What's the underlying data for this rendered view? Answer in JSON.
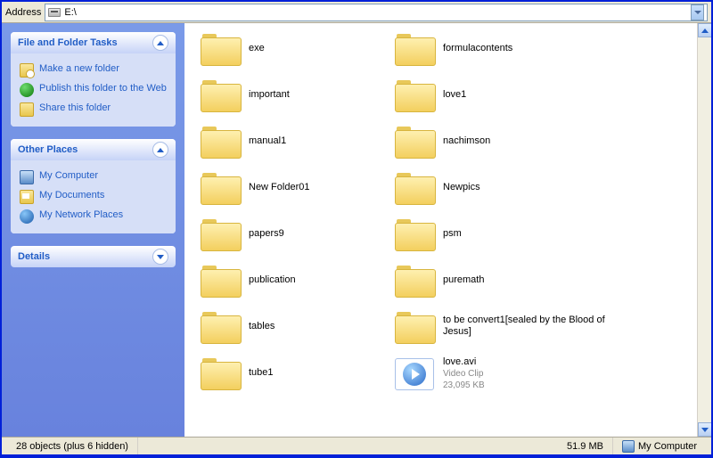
{
  "addressbar": {
    "label": "Address",
    "path": "E:\\"
  },
  "sidebar": {
    "panels": [
      {
        "title": "File and Folder Tasks",
        "expanded": true,
        "tasks": [
          {
            "label": "Make a new folder",
            "icon": "newfolder"
          },
          {
            "label": "Publish this folder to the Web",
            "icon": "publish"
          },
          {
            "label": "Share this folder",
            "icon": "share"
          }
        ]
      },
      {
        "title": "Other Places",
        "expanded": true,
        "tasks": [
          {
            "label": "My Computer",
            "icon": "mycomp"
          },
          {
            "label": "My Documents",
            "icon": "mydocs"
          },
          {
            "label": "My Network Places",
            "icon": "net"
          }
        ]
      },
      {
        "title": "Details",
        "expanded": false,
        "tasks": []
      }
    ]
  },
  "items": [
    {
      "name": "exe",
      "type": "folder"
    },
    {
      "name": "formulacontents",
      "type": "folder"
    },
    {
      "name": "important",
      "type": "folder"
    },
    {
      "name": "love1",
      "type": "folder"
    },
    {
      "name": "manual1",
      "type": "folder"
    },
    {
      "name": "nachimson",
      "type": "folder"
    },
    {
      "name": "New Folder01",
      "type": "folder"
    },
    {
      "name": "Newpics",
      "type": "folder"
    },
    {
      "name": "papers9",
      "type": "folder"
    },
    {
      "name": "psm",
      "type": "folder"
    },
    {
      "name": "publication",
      "type": "folder"
    },
    {
      "name": "puremath",
      "type": "folder"
    },
    {
      "name": "tables",
      "type": "folder"
    },
    {
      "name": "to be convert1[sealed by the Blood of Jesus]",
      "type": "folder"
    },
    {
      "name": "tube1",
      "type": "folder"
    },
    {
      "name": "love.avi",
      "type": "video",
      "sub1": "Video Clip",
      "sub2": "23,095 KB"
    }
  ],
  "statusbar": {
    "left": "28 objects (plus 6 hidden)",
    "size": "51.9 MB",
    "location": "My Computer"
  }
}
